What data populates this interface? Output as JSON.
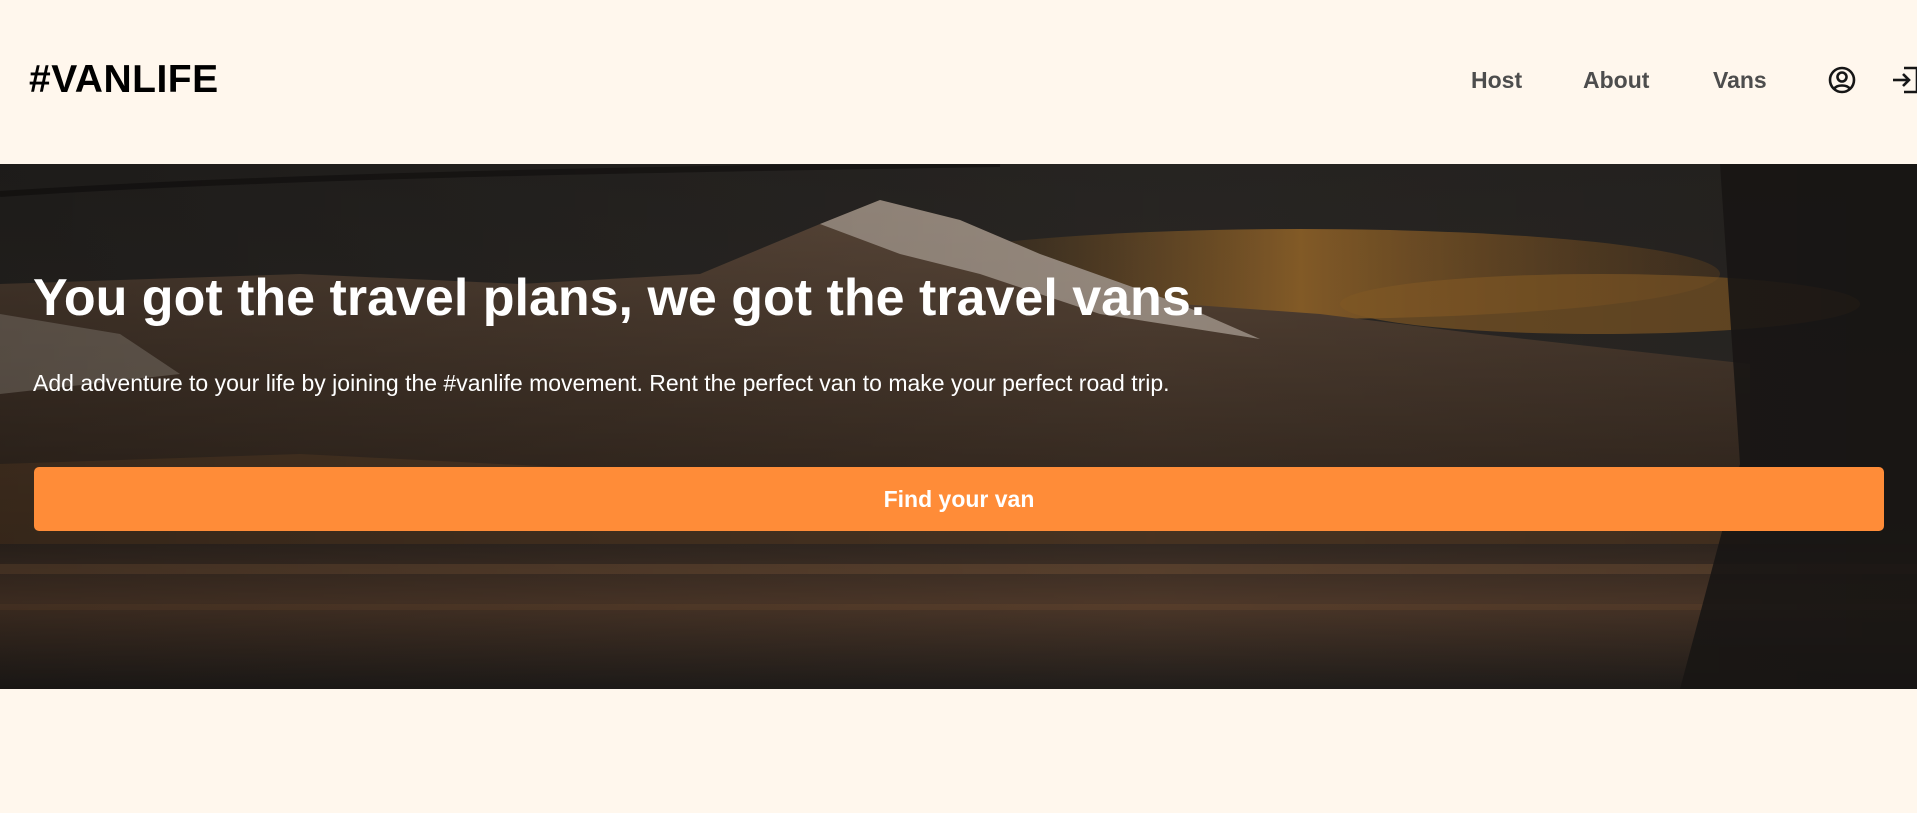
{
  "header": {
    "logo": "#VANLIFE",
    "nav": {
      "host": "Host",
      "about": "About",
      "vans": "Vans"
    },
    "icons": [
      "profile-icon",
      "login-icon"
    ]
  },
  "hero": {
    "title": "You got the travel plans, we got the travel vans.",
    "text": "Add adventure to your life by joining the #vanlife movement. Rent the perfect van to make your perfect road trip.",
    "cta_label": "Find your van"
  },
  "colors": {
    "background": "#FFF7ED",
    "accent": "#FF8C38",
    "nav_text": "#4D4D4D",
    "logo_text": "#000000"
  }
}
